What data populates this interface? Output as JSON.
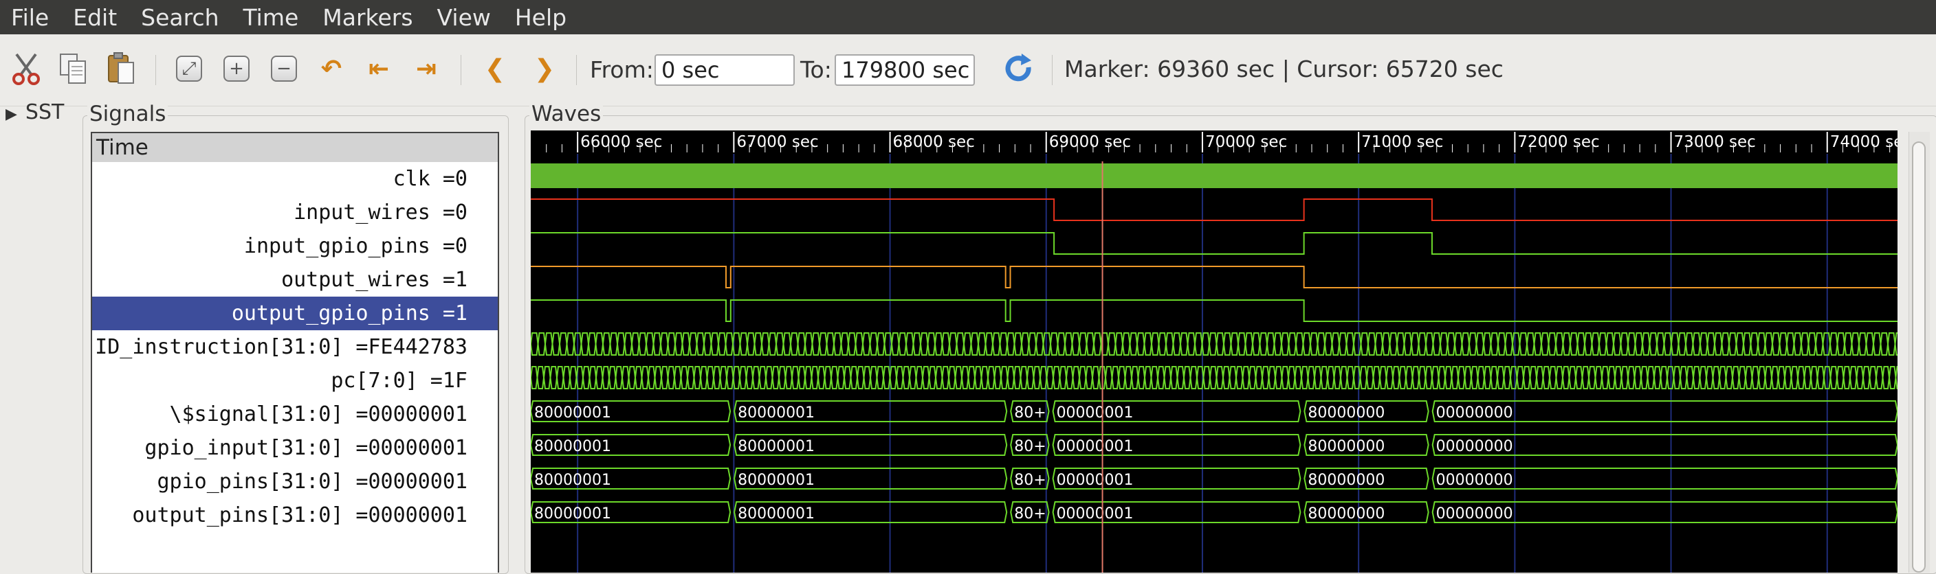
{
  "menu": [
    "File",
    "Edit",
    "Search",
    "Time",
    "Markers",
    "View",
    "Help"
  ],
  "toolbar": {
    "from_label": "From:",
    "from_value": "0 sec",
    "to_label": "To:",
    "to_value": "179800 sec",
    "status": "Marker: 69360 sec  |  Cursor: 65720 sec",
    "icons": [
      "cut-icon",
      "copy-icon",
      "paste-icon",
      "zoom-fit-icon",
      "zoom-in-icon",
      "zoom-out-icon",
      "undo-zoom-icon",
      "zoom-start-icon",
      "zoom-end-icon",
      "prev-edge-icon",
      "next-edge-icon",
      "reload-icon"
    ]
  },
  "sst": {
    "label": "SST"
  },
  "signals": {
    "title": "Signals",
    "header": "Time",
    "rows": [
      "clk =0",
      "input_wires =0",
      "input_gpio_pins =0",
      "output_wires =1",
      "output_gpio_pins =1",
      "ID_instruction[31:0] =FE442783",
      "pc[7:0] =1F",
      "\\$signal[31:0] =00000001",
      "gpio_input[31:0] =00000001",
      "gpio_pins[31:0] =00000001",
      "output_pins[31:0] =00000001"
    ],
    "selected_index": 4
  },
  "waves": {
    "title": "Waves",
    "time_start": 65700,
    "time_end": 74450,
    "tick_labels": [
      "66000 sec",
      "67000 sec",
      "68000 sec",
      "69000 sec",
      "70000 sec",
      "71000 sec",
      "72000 sec",
      "73000 sec",
      "74000 sec"
    ],
    "tick_times": [
      66000,
      67000,
      68000,
      69000,
      70000,
      71000,
      72000,
      73000,
      74000
    ],
    "marker_time": 69360,
    "colors": {
      "bg": "#000000",
      "green": "#6cd92a",
      "red": "#e8321c",
      "orange": "#f09a2a",
      "grid": "#1f2d7a",
      "marker": "#e07868",
      "text": "#ffffff"
    },
    "bit_waves": [
      {
        "color": "red",
        "initial": 1,
        "edges": [
          69050,
          70650,
          71470
        ]
      },
      {
        "color": "green",
        "initial": 1,
        "edges": [
          69050,
          70650,
          71470
        ]
      },
      {
        "color": "orange",
        "initial": 1,
        "edges": [
          66950,
          66980,
          68740,
          68770,
          70650
        ]
      },
      {
        "color": "green",
        "initial": 1,
        "edges": [
          66950,
          66980,
          68740,
          68770,
          70650
        ]
      }
    ],
    "bus_waves": [
      {
        "segments": [
          [
            65700,
            "80000001"
          ],
          [
            66990,
            "80000001"
          ],
          [
            68760,
            "80+"
          ],
          [
            69030,
            "00000001"
          ],
          [
            70640,
            "80000000"
          ],
          [
            71460,
            "00000000"
          ]
        ]
      },
      {
        "segments": [
          [
            65700,
            "80000001"
          ],
          [
            66990,
            "80000001"
          ],
          [
            68760,
            "80+"
          ],
          [
            69030,
            "00000001"
          ],
          [
            70640,
            "80000000"
          ],
          [
            71460,
            "00000000"
          ]
        ]
      },
      {
        "segments": [
          [
            65700,
            "80000001"
          ],
          [
            66990,
            "80000001"
          ],
          [
            68760,
            "80+"
          ],
          [
            69030,
            "00000001"
          ],
          [
            70640,
            "80000000"
          ],
          [
            71460,
            "00000000"
          ]
        ]
      },
      {
        "segments": [
          [
            65700,
            "80000001"
          ],
          [
            66990,
            "80000001"
          ],
          [
            68760,
            "80+"
          ],
          [
            69030,
            "00000001"
          ],
          [
            70640,
            "80000000"
          ],
          [
            71460,
            "00000000"
          ]
        ]
      }
    ]
  }
}
